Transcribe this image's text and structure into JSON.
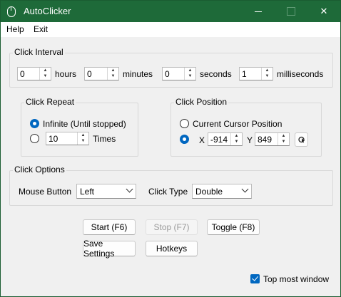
{
  "window": {
    "title": "AutoClicker",
    "close_glyph": "✕"
  },
  "menu": {
    "items": [
      "Help",
      "Exit"
    ]
  },
  "interval": {
    "label": "Click Interval",
    "hours": {
      "value": "0",
      "unit": "hours"
    },
    "minutes": {
      "value": "0",
      "unit": "minutes"
    },
    "seconds": {
      "value": "0",
      "unit": "seconds"
    },
    "milliseconds": {
      "value": "1",
      "unit": "milliseconds"
    }
  },
  "repeat": {
    "label": "Click Repeat",
    "infinite_label": "Infinite (Until stopped)",
    "infinite_selected": true,
    "times_value": "10",
    "times_label": "Times"
  },
  "position": {
    "label": "Click Position",
    "current_label": "Current Cursor Position",
    "current_selected": false,
    "x_label": "X",
    "x_value": "-914",
    "y_label": "Y",
    "y_value": "849",
    "pick_icon": "cursor-pick-icon"
  },
  "options": {
    "label": "Click Options",
    "mouse_button_label": "Mouse Button",
    "mouse_button_value": "Left",
    "click_type_label": "Click Type",
    "click_type_value": "Double"
  },
  "buttons": {
    "start": "Start (F6)",
    "stop": "Stop (F7)",
    "toggle": "Toggle (F8)",
    "save": "Save Settings",
    "hotkeys": "Hotkeys"
  },
  "topmost": {
    "label": "Top most window",
    "checked": true
  },
  "colors": {
    "titlebar": "#1e6a39",
    "accent": "#0067c0"
  }
}
